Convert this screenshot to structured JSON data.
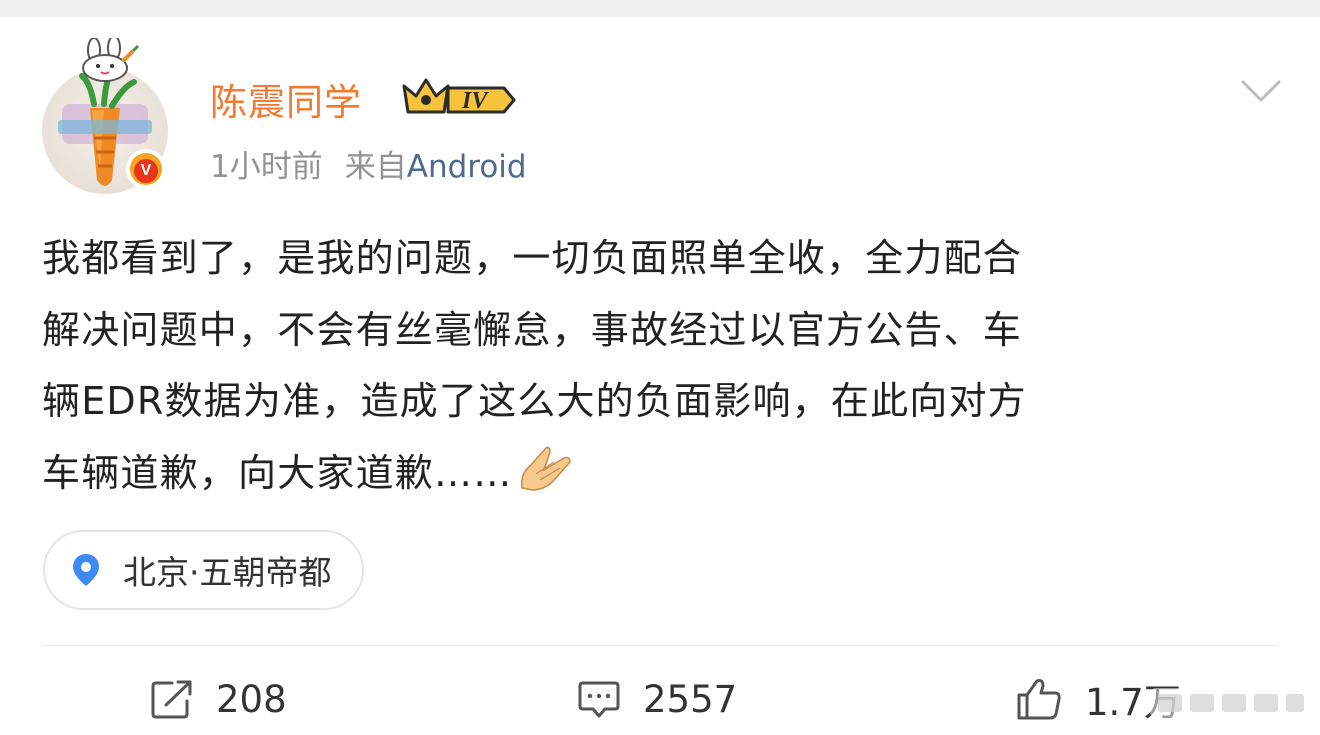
{
  "post": {
    "author": {
      "name": "陈震同学",
      "level_badge": "IV",
      "verified_badge": "V",
      "avatar_icon": "carrot-avatar-icon"
    },
    "meta": {
      "time": "1小时前",
      "source_prefix": "来自",
      "source": "Android"
    },
    "content_lines": [
      "我都看到了，是我的问题，一切负面照单全收，全力配合",
      "解决问题中，不会有丝毫懈怠，事故经过以官方公告、车",
      "辆EDR数据为准，造成了这么大的负面影响，在此向对方",
      "车辆道歉，向大家道歉……"
    ],
    "content_emoji": "folded-hands-emoji",
    "location": {
      "label": "北京·五朝帝都",
      "icon": "map-pin-icon"
    }
  },
  "actions": {
    "repost": {
      "icon": "repost-icon",
      "count": "208"
    },
    "comment": {
      "icon": "comment-icon",
      "count": "2557"
    },
    "like": {
      "icon": "like-icon",
      "count": "1.7万"
    }
  },
  "colors": {
    "username": "#f27a30",
    "source_link": "#4e6a90",
    "meta_text": "#939393",
    "pin": "#3d8bf2",
    "verified": "#f3a521"
  }
}
